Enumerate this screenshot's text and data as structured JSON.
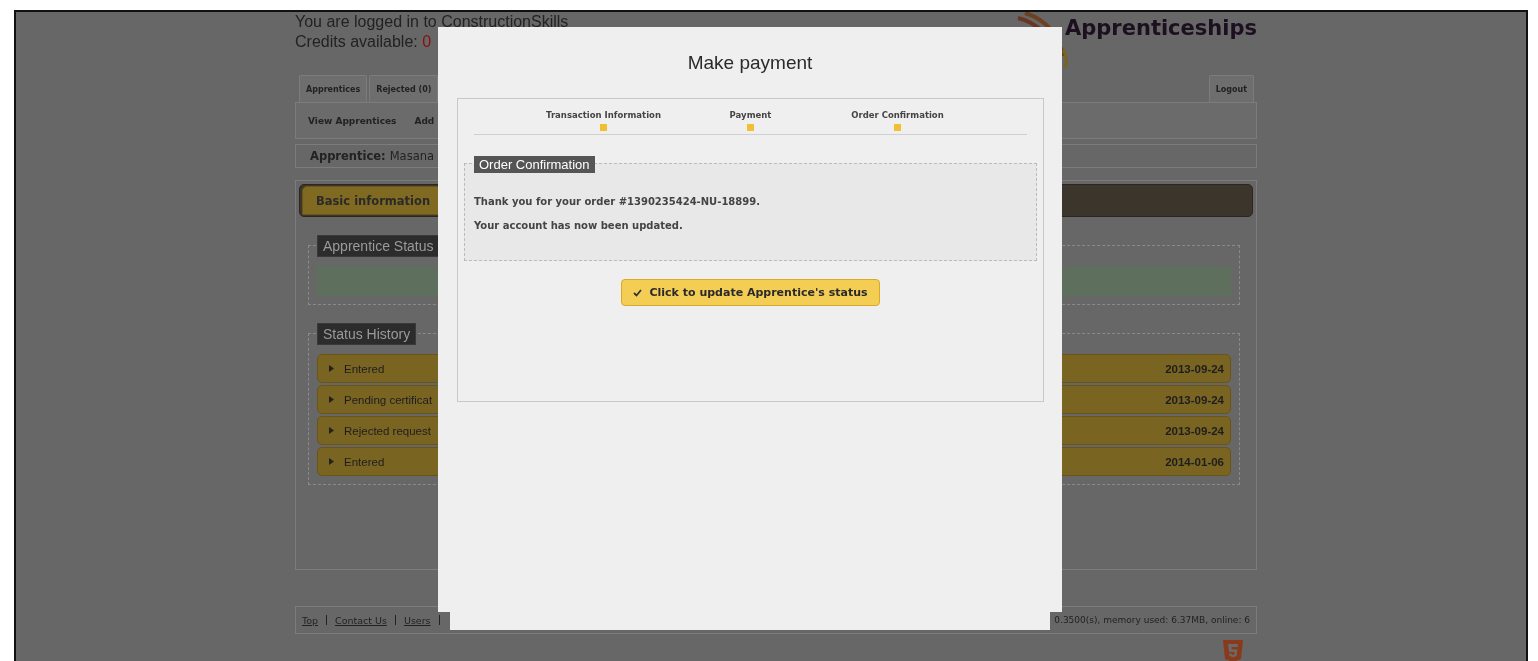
{
  "header": {
    "login_text": "You are logged in to ConstructionSkills",
    "credits_label": "Credits available:",
    "credits_value": "0",
    "logo_text": "Apprenticeships"
  },
  "top_tabs": [
    {
      "label": "Apprentices"
    },
    {
      "label": "Rejected (0)"
    }
  ],
  "logout": "Logout",
  "subnav": [
    "View Apprentices",
    "Add"
  ],
  "apprentice_bar": {
    "label": "Apprentice:",
    "value": "Masana"
  },
  "record_tabs": [
    {
      "label": "Basic information",
      "selected": true
    }
  ],
  "status_section": {
    "legend": "Apprentice Status"
  },
  "history": {
    "legend": "Status History",
    "rows": [
      {
        "label": "Entered",
        "date": "2013-09-24"
      },
      {
        "label": "Pending certificat",
        "date": "2013-09-24"
      },
      {
        "label": "Rejected request",
        "date": "2013-09-24"
      },
      {
        "label": "Entered",
        "date": "2014-01-06"
      }
    ]
  },
  "footer": {
    "links": [
      "Top",
      "Contact Us",
      "Users"
    ],
    "stats": "0.3500(s), memory used: 6.37MB, online: 6"
  },
  "modal": {
    "title": "Make payment",
    "steps": [
      {
        "label": "Transaction Information"
      },
      {
        "label": "Payment"
      },
      {
        "label": "Order Confirmation"
      }
    ],
    "section_legend": "Order Confirmation",
    "messages": [
      "Thank you for your order #1390235424-NU-18899.",
      "Your account has now been updated."
    ],
    "button": "Click to update Apprentice's status"
  }
}
